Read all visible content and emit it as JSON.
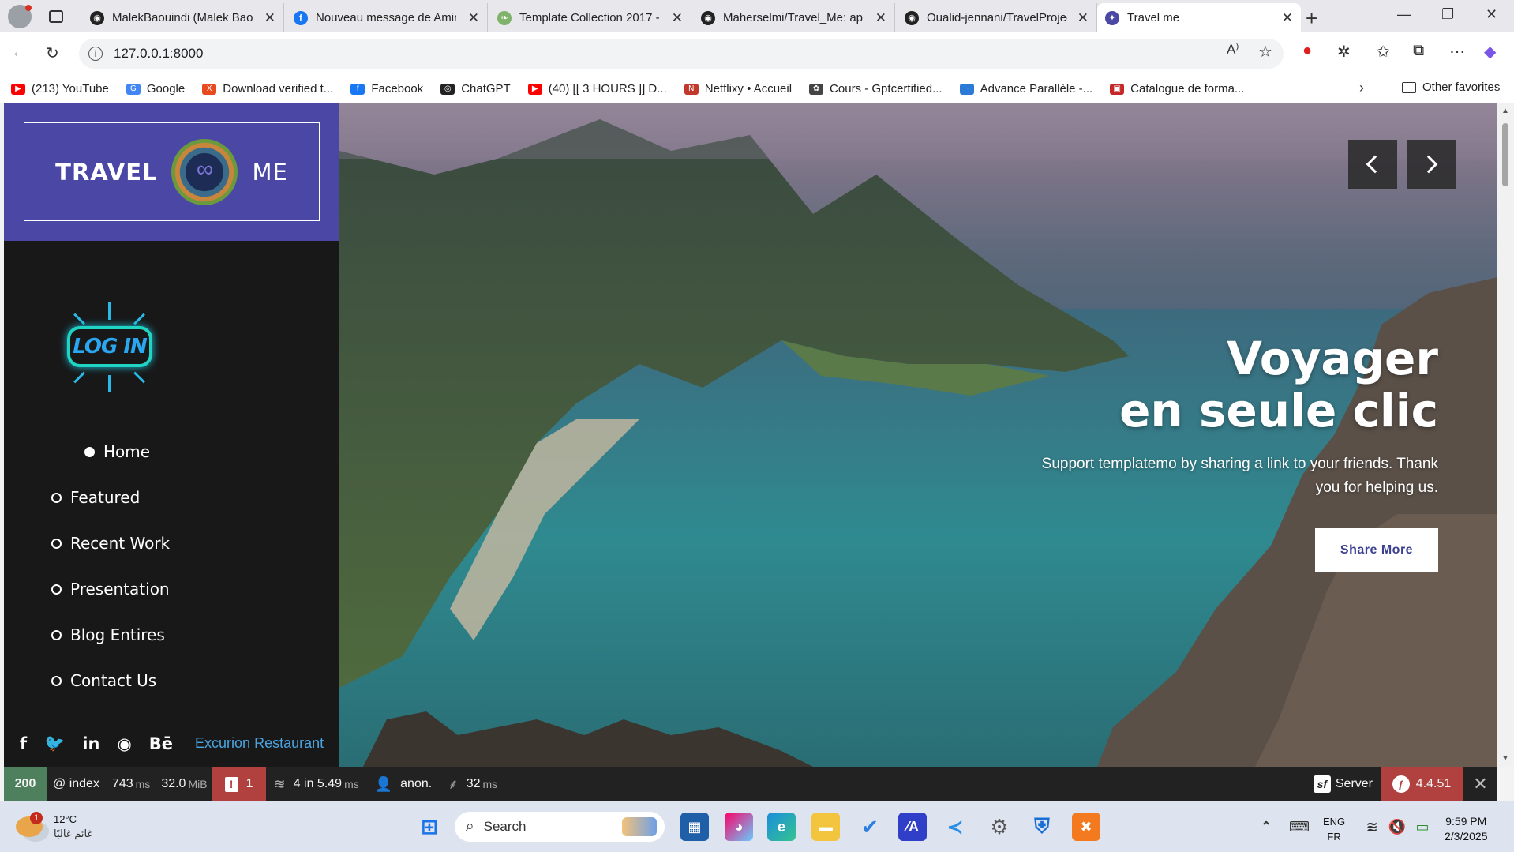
{
  "browser": {
    "tabs": [
      {
        "title": "MalekBaouindi (Malek Baou",
        "favicon": "github-icon",
        "color": "#222222"
      },
      {
        "title": "Nouveau message de Amin",
        "favicon": "facebook-icon",
        "color": "#1877f2"
      },
      {
        "title": "Template Collection 2017 -",
        "favicon": "leaf-icon",
        "color": "#7fb26b"
      },
      {
        "title": "Maherselmi/Travel_Me: app",
        "favicon": "github-icon",
        "color": "#222222"
      },
      {
        "title": "Oualid-jennani/TravelProjec",
        "favicon": "github-icon",
        "color": "#222222"
      },
      {
        "title": "Travel me",
        "favicon": "travel-icon",
        "color": "#4a47a5"
      }
    ],
    "active_tab": 5,
    "url": "127.0.0.1:8000",
    "bookmarks": [
      {
        "label": "(213) YouTube",
        "icon": "youtube-icon",
        "color": "#ff0000"
      },
      {
        "label": "Google",
        "icon": "google-icon",
        "color": "#4285f4"
      },
      {
        "label": "Download verified t...",
        "icon": "x-icon",
        "color": "#e8491d"
      },
      {
        "label": "Facebook",
        "icon": "facebook-icon",
        "color": "#1877f2"
      },
      {
        "label": "ChatGPT",
        "icon": "chatgpt-icon",
        "color": "#222222"
      },
      {
        "label": "(40) [[ 3 HOURS ]] D...",
        "icon": "youtube-icon",
        "color": "#ff0000"
      },
      {
        "label": "Netflixy • Accueil",
        "icon": "netflixy-icon",
        "color": "#c0392b"
      },
      {
        "label": "Cours - Gptcertified...",
        "icon": "openai-icon",
        "color": "#444444"
      },
      {
        "label": "Advance Parallèle -...",
        "icon": "wave-icon",
        "color": "#2b7bd6"
      },
      {
        "label": "Catalogue de forma...",
        "icon": "catalogue-icon",
        "color": "#c62828"
      }
    ],
    "other_favorites": "Other favorites"
  },
  "site": {
    "logo": {
      "left": "TRAVEL",
      "right": "ME"
    },
    "login_logo": "LOG IN",
    "menu": [
      {
        "label": "Home",
        "active": true
      },
      {
        "label": "Featured",
        "active": false
      },
      {
        "label": "Recent Work",
        "active": false
      },
      {
        "label": "Presentation",
        "active": false
      },
      {
        "label": "Blog Entires",
        "active": false
      },
      {
        "label": "Contact Us",
        "active": false
      }
    ],
    "social_icons": [
      "facebook-icon",
      "twitter-icon",
      "linkedin-icon",
      "rss-icon",
      "behance-icon"
    ],
    "social_glyphs": [
      "f",
      "🐦",
      "in",
      "◉",
      "Bē"
    ],
    "footer_link": "Excurion Restaurant",
    "hero": {
      "title": "Voyager\nen seule clic",
      "subtitle": "Support templatemo by sharing a link to your friends. Thank you for helping us.",
      "button": "Share More"
    }
  },
  "debug_toolbar": {
    "status": "200",
    "route": "@ index",
    "time": "743",
    "time_unit": "ms",
    "memory": "32.0",
    "memory_unit": "MiB",
    "errors": "1",
    "cache": "4 in 5.49",
    "cache_unit": "ms",
    "user": "anon.",
    "twig": "32",
    "twig_unit": "ms",
    "server": "Server",
    "version": "4.4.51",
    "colors": {
      "ok": "#4f805d",
      "error": "#b0413e",
      "symfony": "#b0413e"
    }
  },
  "taskbar": {
    "weather_temp": "12°C",
    "weather_desc": "غائم غالبًا",
    "weather_badge": "1",
    "search": "Search",
    "lang_top": "ENG",
    "lang_bottom": "FR",
    "time": "9:59 PM",
    "date": "2/3/2025"
  }
}
